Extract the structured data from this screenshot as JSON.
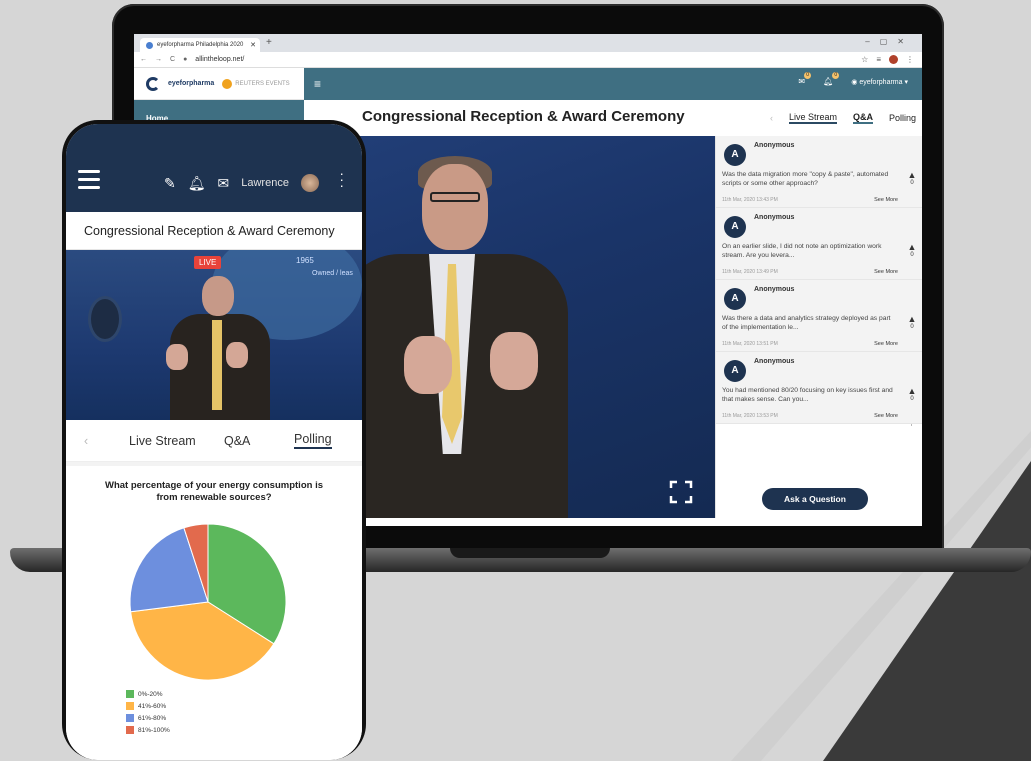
{
  "browser": {
    "tab_title": "eyeforpharma Philadelphia 2020",
    "url": "allintheloop.net/"
  },
  "app": {
    "logo_text": "eyeforpharma",
    "partner_logo_text": "REUTERS EVENTS",
    "user_menu": "eyeforpharma",
    "mail_badge": "0",
    "bell_badge": "0",
    "sidebar": {
      "home": "Home"
    },
    "event_title": "Congressional Reception & Award Ceremony",
    "tabs": {
      "live_stream": "Live Stream",
      "qa": "Q&A",
      "polling": "Polling"
    },
    "ask_button": "Ask a Question",
    "questions": [
      {
        "avatar_letter": "A",
        "author": "Anonymous",
        "text": "Was the data migration more \"copy & paste\", automated scripts or some other approach?",
        "time": "11th Mar, 2020 13:43 PM",
        "see_more": "See More",
        "votes": "0"
      },
      {
        "avatar_letter": "A",
        "author": "Anonymous",
        "text": "On an earlier slide, I did not note an optimization work stream. Are you levera...",
        "time": "11th Mar, 2020 13:49 PM",
        "see_more": "See More",
        "votes": "0"
      },
      {
        "avatar_letter": "A",
        "author": "Anonymous",
        "text": "Was there a data and analytics strategy deployed as part of the implementation le...",
        "time": "11th Mar, 2020 13:51 PM",
        "see_more": "See More",
        "votes": "0"
      },
      {
        "avatar_letter": "A",
        "author": "Anonymous",
        "text": "You had mentioned 80/20 focusing on key issues first and that makes sense. Can you...",
        "time": "11th Mar, 2020 13:53 PM",
        "see_more": "See More",
        "votes": "0"
      }
    ]
  },
  "phone": {
    "user_name": "Lawrence",
    "event_title": "Congressional Reception & Award Ceremony",
    "live_badge": "LIVE",
    "video_year": "1965",
    "video_caption": "Owned / leas",
    "tabs": {
      "live_stream": "Live Stream",
      "qa": "Q&A",
      "polling": "Polling"
    },
    "poll_question": "What percentage of your energy consumption is from renewable sources?"
  },
  "chart_data": {
    "type": "pie",
    "title": "What percentage of your energy consumption is from renewable sources?",
    "categories": [
      "0%-20%",
      "41%-60%",
      "61%-80%",
      "81%-100%"
    ],
    "values": [
      34,
      39,
      22,
      5
    ],
    "colors": [
      "#5cb85c",
      "#ffb547",
      "#6d8fde",
      "#e26a4d"
    ]
  }
}
